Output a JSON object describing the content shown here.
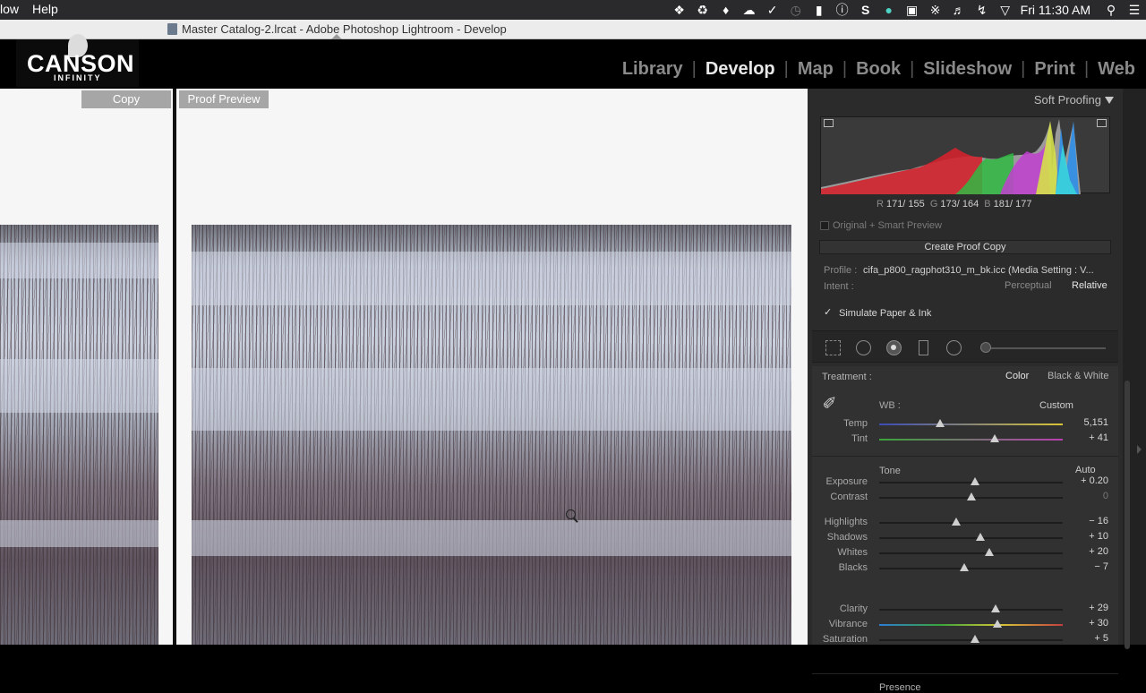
{
  "menubar": {
    "items": [
      "low",
      "Help"
    ],
    "clock": "Fri 11:30 AM",
    "tray_icons": [
      "dropbox-icon",
      "evernote-icon",
      "elephant-icon",
      "cloud-icon",
      "checkmark-icon",
      "clock-icon",
      "bookmark-icon",
      "info-icon",
      "s-icon",
      "creative-cloud-icon",
      "screen-icon",
      "bluetooth-icon",
      "volume-icon",
      "battery-icon",
      "wifi-icon",
      "search-icon",
      "list-icon"
    ]
  },
  "window": {
    "title": "Master Catalog-2.lrcat - Adobe Photoshop Lightroom - Develop"
  },
  "brand": {
    "name": "CANSON",
    "sub": "INFINITY"
  },
  "modules": [
    "Library",
    "Develop",
    "Map",
    "Book",
    "Slideshow",
    "Print",
    "Web"
  ],
  "active_module": "Develop",
  "viewer": {
    "left_tag": "Copy",
    "right_tag": "Proof Preview"
  },
  "panel": {
    "header": "Soft Proofing",
    "rgb": {
      "r_label": "R",
      "r": "171/ 155",
      "g_label": "G",
      "g": "173/ 164",
      "b_label": "B",
      "b": "181/ 177"
    },
    "original_smart": "Original + Smart Preview",
    "create_proof_copy": "Create Proof Copy",
    "profile_label": "Profile :",
    "profile_value": "cifa_p800_ragphot310_m_bk.icc (Media Setting : V...",
    "intent_label": "Intent :",
    "intent_options": [
      "Perceptual",
      "Relative"
    ],
    "intent_selected": "Relative",
    "simulate": "Simulate Paper & Ink",
    "simulate_checked": true
  },
  "basic": {
    "treatment_label": "Treatment :",
    "treatment_options": [
      "Color",
      "Black & White"
    ],
    "treatment_selected": "Color",
    "wb_label": "WB :",
    "wb_value": "Custom",
    "tone_label": "Tone",
    "auto_label": "Auto",
    "presence_label": "Presence",
    "sliders": {
      "temp": {
        "label": "Temp",
        "value": "5,151",
        "pos": 0.33
      },
      "tint": {
        "label": "Tint",
        "value": "+ 41",
        "pos": 0.63
      },
      "exposure": {
        "label": "Exposure",
        "value": "+ 0.20",
        "pos": 0.52
      },
      "contrast": {
        "label": "Contrast",
        "value": "0",
        "pos": 0.5
      },
      "highlights": {
        "label": "Highlights",
        "value": "− 16",
        "pos": 0.42
      },
      "shadows": {
        "label": "Shadows",
        "value": "+ 10",
        "pos": 0.55
      },
      "whites": {
        "label": "Whites",
        "value": "+ 20",
        "pos": 0.6
      },
      "blacks": {
        "label": "Blacks",
        "value": "− 7",
        "pos": 0.465
      },
      "clarity": {
        "label": "Clarity",
        "value": "+ 29",
        "pos": 0.635
      },
      "vibrance": {
        "label": "Vibrance",
        "value": "+ 30",
        "pos": 0.645
      },
      "saturation": {
        "label": "Saturation",
        "value": "+ 5",
        "pos": 0.52
      }
    }
  }
}
